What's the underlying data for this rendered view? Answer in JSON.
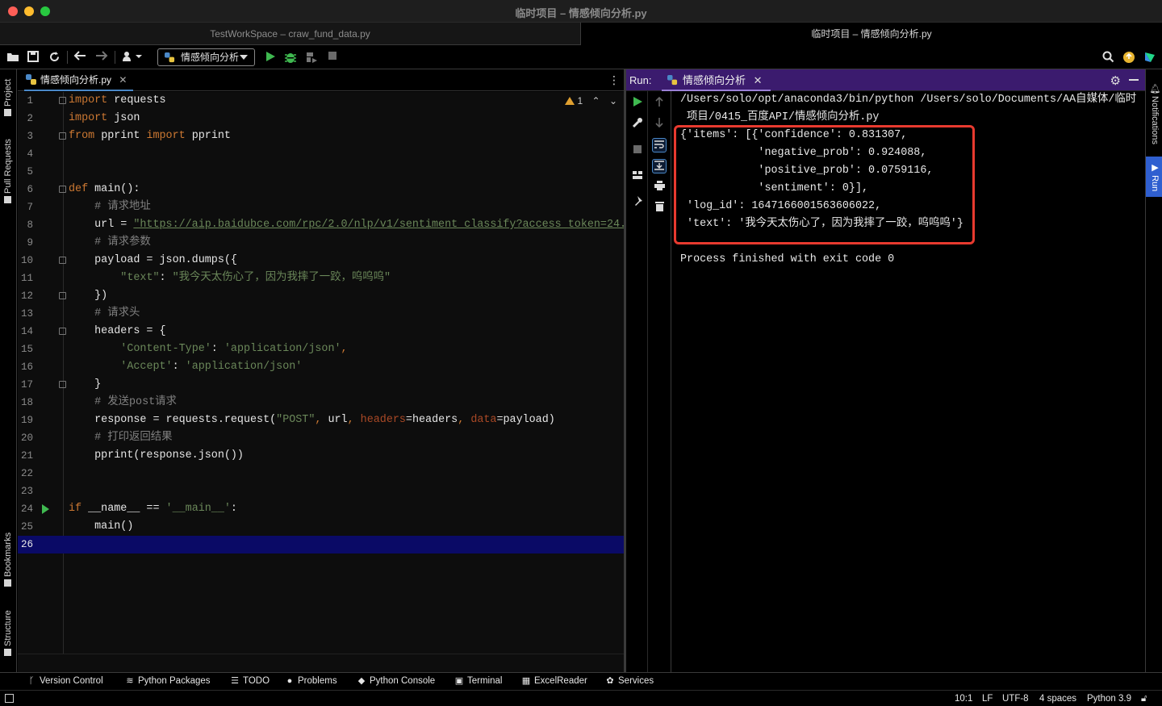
{
  "window": {
    "title": "临时项目 – 情感倾向分析.py",
    "project_tabs": [
      "TestWorkSpace – craw_fund_data.py",
      "临时项目 – 情感倾向分析.py"
    ]
  },
  "toolbar": {
    "run_config": "情感倾向分析"
  },
  "left_strip": [
    "Project",
    "Pull Requests",
    "Bookmarks",
    "Structure"
  ],
  "right_strip": [
    "Notifications",
    "Run"
  ],
  "editor": {
    "tab_label": "情感倾向分析.py",
    "inspection_count": "1",
    "current_line": 26,
    "lines": [
      {
        "n": "1",
        "code": "import requests"
      },
      {
        "n": "2",
        "code": "import json"
      },
      {
        "n": "3",
        "code": "from pprint import pprint"
      },
      {
        "n": "4",
        "code": ""
      },
      {
        "n": "5",
        "code": ""
      },
      {
        "n": "6",
        "code": "def main():"
      },
      {
        "n": "7",
        "code": "    # 请求地址"
      },
      {
        "n": "8",
        "code": "    url = \"https://aip.baidubce.com/rpc/2.0/nlp/v1/sentiment_classify?access_token=24."
      },
      {
        "n": "9",
        "code": "    # 请求参数"
      },
      {
        "n": "10",
        "code": "    payload = json.dumps({"
      },
      {
        "n": "11",
        "code": "        \"text\": \"我今天太伤心了，因为我摔了一跤，呜呜呜\""
      },
      {
        "n": "12",
        "code": "    })"
      },
      {
        "n": "13",
        "code": "    # 请求头"
      },
      {
        "n": "14",
        "code": "    headers = {"
      },
      {
        "n": "15",
        "code": "        'Content-Type': 'application/json',"
      },
      {
        "n": "16",
        "code": "        'Accept': 'application/json'"
      },
      {
        "n": "17",
        "code": "    }"
      },
      {
        "n": "18",
        "code": "    # 发送post请求"
      },
      {
        "n": "19",
        "code": "    response = requests.request(\"POST\", url, headers=headers, data=payload)"
      },
      {
        "n": "20",
        "code": "    # 打印返回结果"
      },
      {
        "n": "21",
        "code": "    pprint(response.json())"
      },
      {
        "n": "22",
        "code": ""
      },
      {
        "n": "23",
        "code": ""
      },
      {
        "n": "24",
        "code": "if __name__ == '__main__':"
      },
      {
        "n": "25",
        "code": "    main()"
      },
      {
        "n": "26",
        "code": ""
      }
    ]
  },
  "run": {
    "label": "Run:",
    "tab_label": "情感倾向分析",
    "output": [
      "/Users/solo/opt/anaconda3/bin/python /Users/solo/Documents/AA自媒体/临时",
      " 项目/0415_百度API/情感倾向分析.py",
      "{'items': [{'confidence': 0.831307,",
      "            'negative_prob': 0.924088,",
      "            'positive_prob': 0.0759116,",
      "            'sentiment': 0}],",
      " 'log_id': 1647166001563606022,",
      " 'text': '我今天太伤心了，因为我摔了一跤，呜呜呜'}",
      "",
      "Process finished with exit code 0"
    ]
  },
  "tool_windows": [
    "Version Control",
    "Python Packages",
    "TODO",
    "Problems",
    "Python Console",
    "Terminal",
    "ExcelReader",
    "Services"
  ],
  "status": {
    "position": "10:1",
    "line_sep": "LF",
    "encoding": "UTF-8",
    "indent": "4 spaces",
    "interpreter": "Python 3.9"
  },
  "colors": {
    "run_header": "#3b1b6e",
    "highlight_box": "#e83a2f",
    "current_line": "#0a0a66",
    "run_green": "#3fb950"
  }
}
